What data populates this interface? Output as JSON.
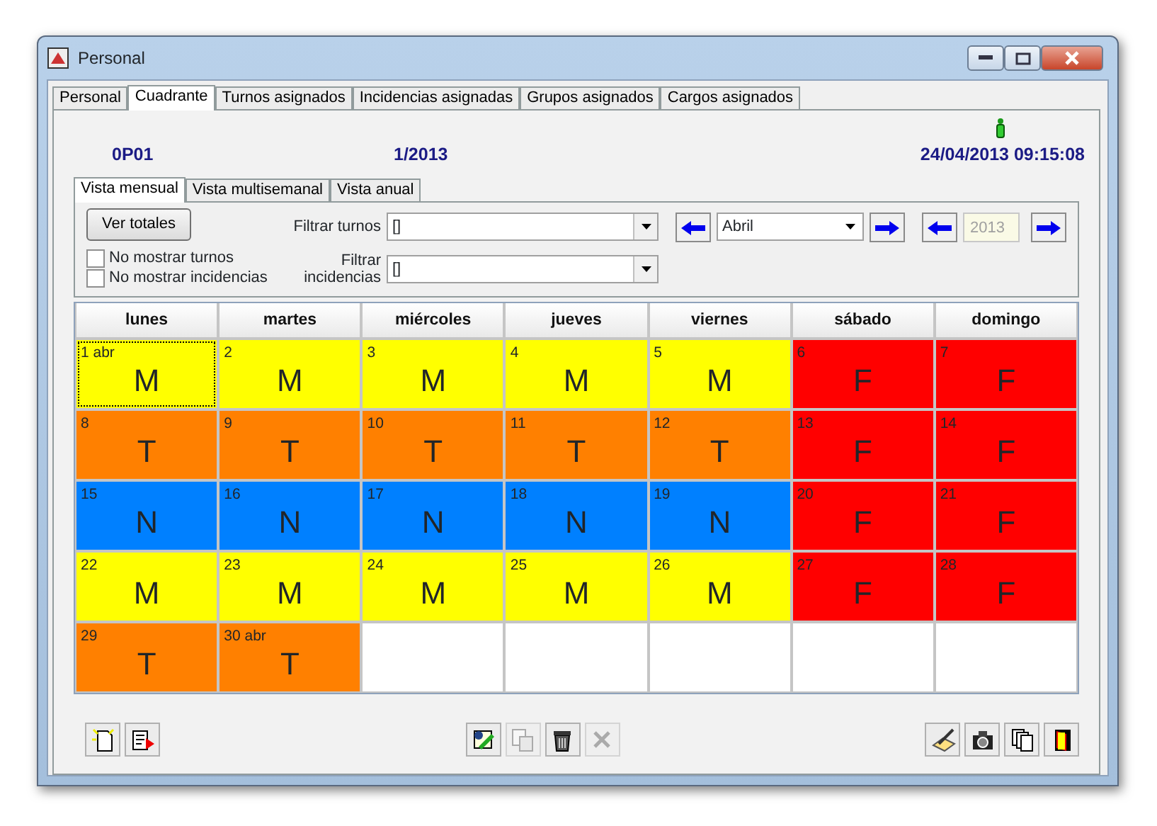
{
  "window": {
    "title": "Personal"
  },
  "tabs": [
    {
      "label": "Personal",
      "selected": false
    },
    {
      "label": "Cuadrante",
      "selected": true
    },
    {
      "label": "Turnos asignados",
      "selected": false
    },
    {
      "label": "Incidencias asignadas",
      "selected": false
    },
    {
      "label": "Grupos asignados",
      "selected": false
    },
    {
      "label": "Cargos asignados",
      "selected": false
    }
  ],
  "header": {
    "code": "0P01",
    "period": "1/2013",
    "datetime": "24/04/2013 09:15:08"
  },
  "view_tabs": [
    {
      "label": "Vista mensual",
      "selected": true
    },
    {
      "label": "Vista multisemanal",
      "selected": false
    },
    {
      "label": "Vista anual",
      "selected": false
    }
  ],
  "filters": {
    "totals_button": "Ver totales",
    "checkboxes": [
      {
        "label": "No mostrar turnos",
        "checked": false
      },
      {
        "label": "No mostrar incidencias",
        "checked": false
      }
    ],
    "shift_filter": {
      "label": "Filtrar turnos",
      "value": "[]"
    },
    "incident_filter": {
      "label": "Filtrar incidencias",
      "value": "[]"
    },
    "month": "Abril",
    "year": {
      "value": "2013",
      "disabled": true
    }
  },
  "calendar": {
    "columns": [
      "lunes",
      "martes",
      "miércoles",
      "jueves",
      "viernes",
      "sábado",
      "domingo"
    ],
    "weeks": [
      [
        {
          "day": "1 abr",
          "shift": "M",
          "color": "#ffff00",
          "selected": true
        },
        {
          "day": "2",
          "shift": "M",
          "color": "#ffff00",
          "selected": false
        },
        {
          "day": "3",
          "shift": "M",
          "color": "#ffff00",
          "selected": false
        },
        {
          "day": "4",
          "shift": "M",
          "color": "#ffff00",
          "selected": false
        },
        {
          "day": "5",
          "shift": "M",
          "color": "#ffff00",
          "selected": false
        },
        {
          "day": "6",
          "shift": "F",
          "color": "#ff0000",
          "selected": false
        },
        {
          "day": "7",
          "shift": "F",
          "color": "#ff0000",
          "selected": false
        }
      ],
      [
        {
          "day": "8",
          "shift": "T",
          "color": "#ff8000",
          "selected": false
        },
        {
          "day": "9",
          "shift": "T",
          "color": "#ff8000",
          "selected": false
        },
        {
          "day": "10",
          "shift": "T",
          "color": "#ff8000",
          "selected": false
        },
        {
          "day": "11",
          "shift": "T",
          "color": "#ff8000",
          "selected": false
        },
        {
          "day": "12",
          "shift": "T",
          "color": "#ff8000",
          "selected": false
        },
        {
          "day": "13",
          "shift": "F",
          "color": "#ff0000",
          "selected": false
        },
        {
          "day": "14",
          "shift": "F",
          "color": "#ff0000",
          "selected": false
        }
      ],
      [
        {
          "day": "15",
          "shift": "N",
          "color": "#0080ff",
          "selected": false
        },
        {
          "day": "16",
          "shift": "N",
          "color": "#0080ff",
          "selected": false
        },
        {
          "day": "17",
          "shift": "N",
          "color": "#0080ff",
          "selected": false
        },
        {
          "day": "18",
          "shift": "N",
          "color": "#0080ff",
          "selected": false
        },
        {
          "day": "19",
          "shift": "N",
          "color": "#0080ff",
          "selected": false
        },
        {
          "day": "20",
          "shift": "F",
          "color": "#ff0000",
          "selected": false
        },
        {
          "day": "21",
          "shift": "F",
          "color": "#ff0000",
          "selected": false
        }
      ],
      [
        {
          "day": "22",
          "shift": "M",
          "color": "#ffff00",
          "selected": false
        },
        {
          "day": "23",
          "shift": "M",
          "color": "#ffff00",
          "selected": false
        },
        {
          "day": "24",
          "shift": "M",
          "color": "#ffff00",
          "selected": false
        },
        {
          "day": "25",
          "shift": "M",
          "color": "#ffff00",
          "selected": false
        },
        {
          "day": "26",
          "shift": "M",
          "color": "#ffff00",
          "selected": false
        },
        {
          "day": "27",
          "shift": "F",
          "color": "#ff0000",
          "selected": false
        },
        {
          "day": "28",
          "shift": "F",
          "color": "#ff0000",
          "selected": false
        }
      ],
      [
        {
          "day": "29",
          "shift": "T",
          "color": "#ff8000",
          "selected": false
        },
        {
          "day": "30 abr",
          "shift": "T",
          "color": "#ff8000",
          "selected": false
        }
      ]
    ]
  },
  "toolbar": [
    [
      {
        "kind": "new",
        "disabled": false
      },
      {
        "kind": "export",
        "disabled": false
      }
    ],
    [
      {
        "kind": "edit",
        "disabled": false
      },
      {
        "kind": "copy",
        "disabled": true
      },
      {
        "kind": "delete",
        "disabled": false
      },
      {
        "kind": "cancel",
        "disabled": true
      }
    ],
    [
      {
        "kind": "sign",
        "disabled": false
      },
      {
        "kind": "camera",
        "disabled": false
      },
      {
        "kind": "pages",
        "disabled": false
      },
      {
        "kind": "exit",
        "disabled": false
      }
    ]
  ]
}
